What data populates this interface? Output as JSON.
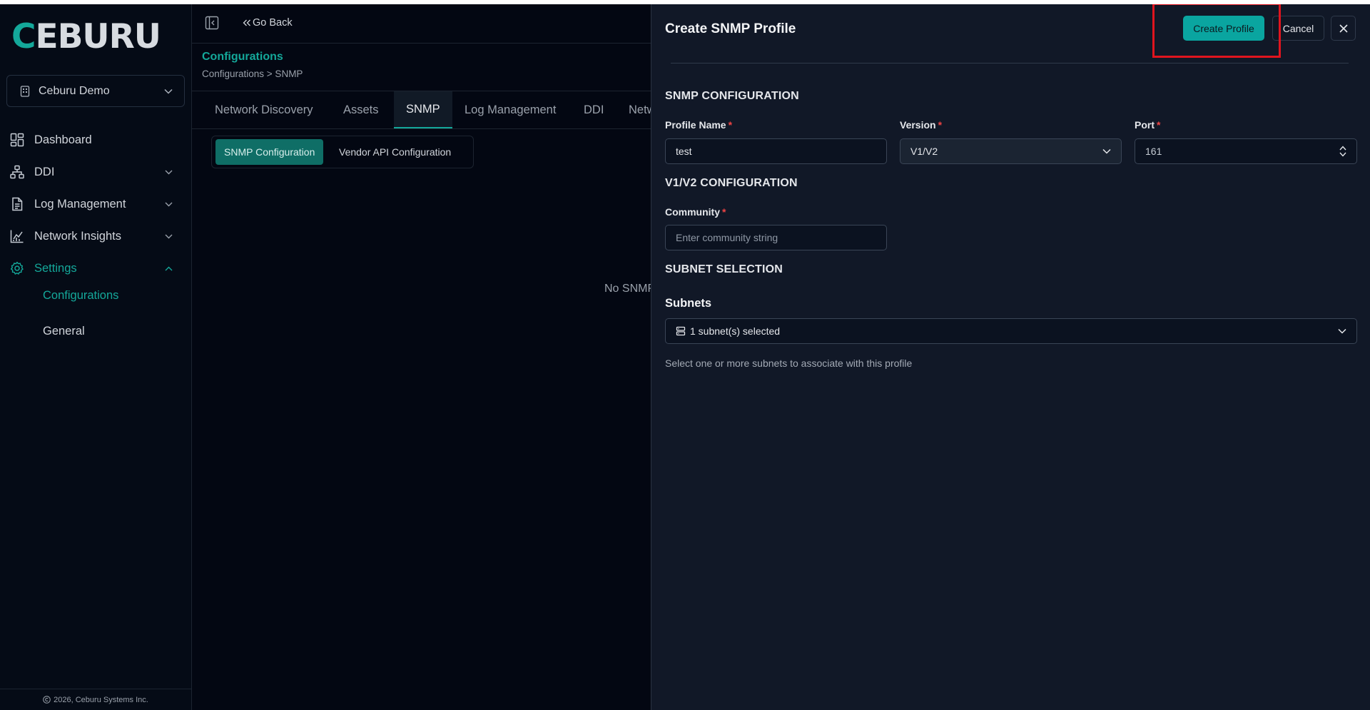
{
  "sidebar": {
    "logo": "CEBURU",
    "org_name": "Ceburu Demo",
    "items": [
      {
        "label": "Dashboard"
      },
      {
        "label": "DDI"
      },
      {
        "label": "Log Management"
      },
      {
        "label": "Network Insights"
      },
      {
        "label": "Settings"
      }
    ],
    "subitems": [
      {
        "label": "Configurations"
      },
      {
        "label": "General"
      }
    ],
    "copyright": "2026, Ceburu Systems Inc."
  },
  "header": {
    "go_back": "Go Back",
    "title": "Configurations",
    "breadcrumb": "Configurations > SNMP"
  },
  "tabs": [
    "Network Discovery",
    "Assets",
    "SNMP",
    "Log Management",
    "DDI",
    "Netw"
  ],
  "subtabs": [
    "SNMP Configuration",
    "Vendor API Configuration"
  ],
  "empty_text": "No SNMP",
  "drawer": {
    "title": "Create SNMP Profile",
    "create_label": "Create Profile",
    "cancel_label": "Cancel",
    "section_snmp": "SNMP CONFIGURATION",
    "profile_name_label": "Profile Name",
    "profile_name_value": "test",
    "version_label": "Version",
    "version_value": "V1/V2",
    "port_label": "Port",
    "port_value": "161",
    "section_v1v2": "V1/V2 CONFIGURATION",
    "community_label": "Community",
    "community_placeholder": "Enter community string",
    "section_subnet": "SUBNET SELECTION",
    "subnets_label": "Subnets",
    "subnets_value": "1 subnet(s) selected",
    "subnets_help": "Select one or more subnets to associate with this profile",
    "required_mark": "*"
  },
  "colors": {
    "accent": "#14a89a",
    "button": "#0aa5a0",
    "highlight": "#e0141e",
    "required": "#ef4444"
  }
}
